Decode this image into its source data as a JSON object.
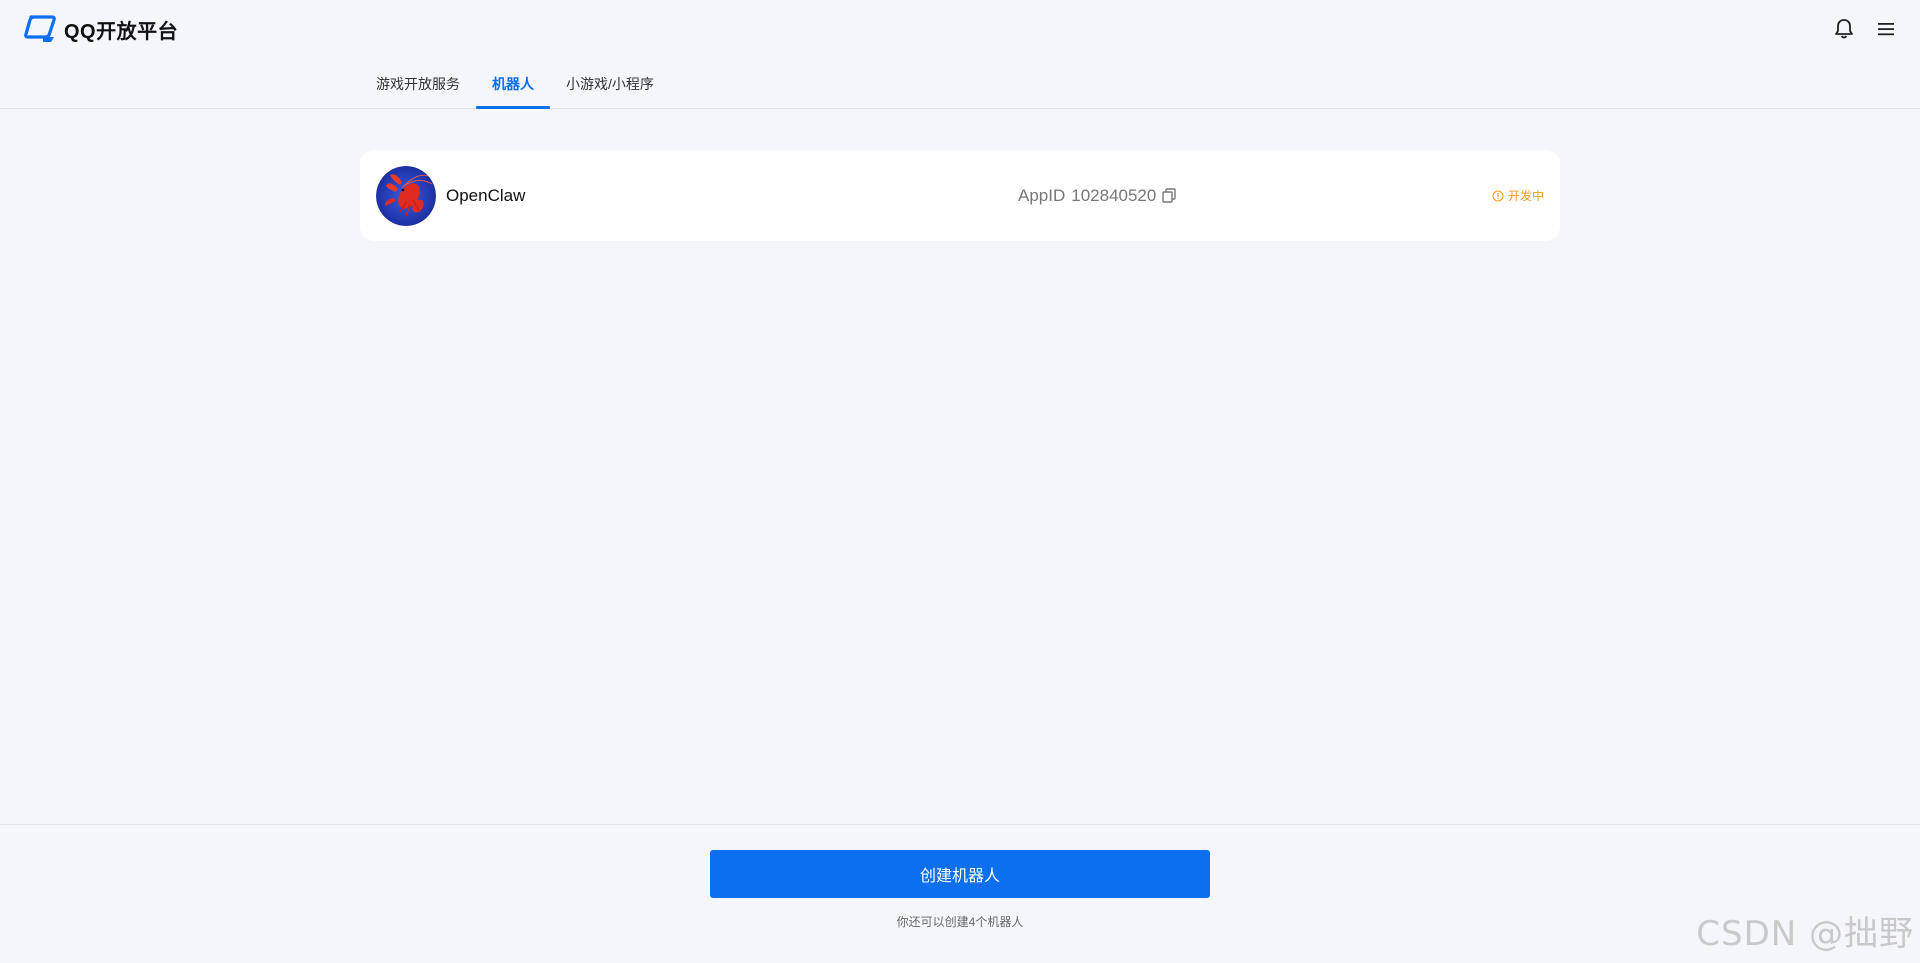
{
  "header": {
    "logo_text": "QQ开放平台",
    "icons": [
      "bell-icon",
      "menu-icon"
    ]
  },
  "tabs": [
    {
      "label": "游戏开放服务",
      "active": false
    },
    {
      "label": "机器人",
      "active": true
    },
    {
      "label": "小游戏/小程序",
      "active": false
    }
  ],
  "bots": [
    {
      "name": "OpenClaw",
      "appid_label": "AppID",
      "appid": "102840520",
      "status": "开发中",
      "avatar_icon": "lobster-avatar"
    }
  ],
  "footer": {
    "create_button": "创建机器人",
    "remaining_hint": "你还可以创建4个机器人"
  },
  "watermark": "CSDN @拙野",
  "colors": {
    "accent": "#0b6ff0",
    "status_dev": "#f59a23",
    "background": "#f4f6fc"
  }
}
